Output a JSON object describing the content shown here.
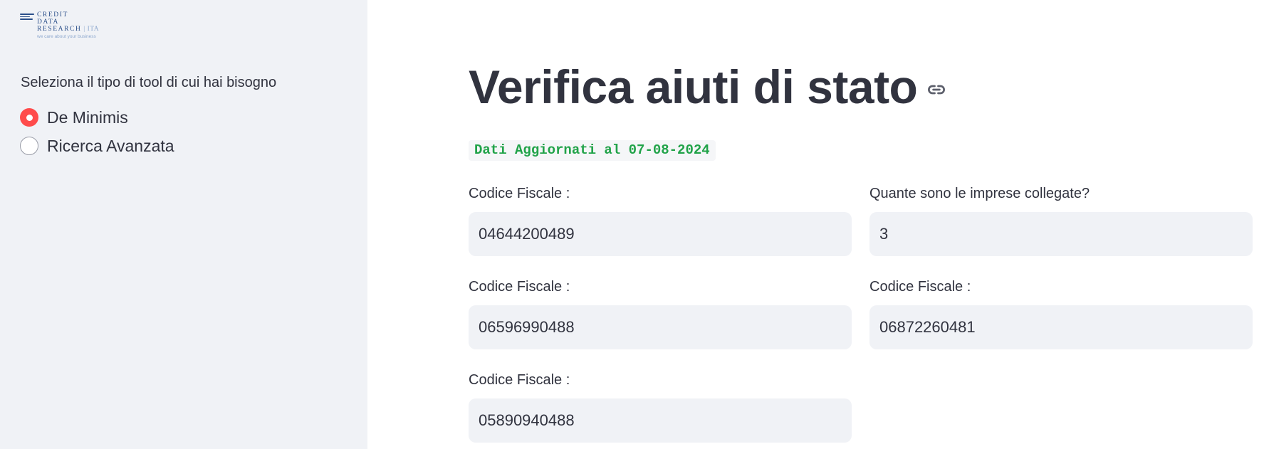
{
  "sidebar": {
    "logo": {
      "line1": "CREDIT",
      "line2": "DATA",
      "line3": "RESEARCH",
      "suffix": "ITA",
      "tagline": "we care about your business"
    },
    "radio_group": {
      "label": "Seleziona il tipo di tool di cui hai bisogno",
      "options": [
        {
          "label": "De Minimis",
          "selected": true
        },
        {
          "label": "Ricerca Avanzata",
          "selected": false
        }
      ]
    }
  },
  "main": {
    "title": "Verifica aiuti di stato",
    "update_badge": "Dati Aggiornati al 07-08-2024",
    "fields": [
      {
        "label": "Codice Fiscale :",
        "value": "04644200489"
      },
      {
        "label": "Quante sono le imprese collegate?",
        "value": "3"
      },
      {
        "label": "Codice Fiscale :",
        "value": "06596990488"
      },
      {
        "label": "Codice Fiscale :",
        "value": "06872260481"
      },
      {
        "label": "Codice Fiscale :",
        "value": "05890940488"
      }
    ]
  },
  "colors": {
    "accent": "#ff4b4b",
    "sidebar_bg": "#f0f2f6",
    "input_bg": "#f0f2f6",
    "badge_text": "#21a349",
    "text": "#31333f"
  },
  "icons": {
    "title_anchor": "link-icon"
  }
}
